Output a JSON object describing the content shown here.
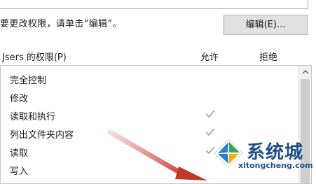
{
  "instruction": "要更改权限，请单击“编辑”。",
  "edit_button_label": "编辑(E)...",
  "permissions_header": {
    "name": "Jsers 的权限(P)",
    "allow": "允许",
    "deny": "拒绝"
  },
  "permissions": [
    {
      "name": "完全控制",
      "allow": false,
      "deny": false
    },
    {
      "name": "修改",
      "allow": false,
      "deny": false
    },
    {
      "name": "读取和执行",
      "allow": true,
      "deny": false
    },
    {
      "name": "列出文件夹内容",
      "allow": true,
      "deny": false
    },
    {
      "name": "读取",
      "allow": true,
      "deny": false
    },
    {
      "name": "写入",
      "allow": false,
      "deny": false
    }
  ],
  "watermark": {
    "title": "系统城",
    "url": "xitongcheng.com"
  },
  "colors": {
    "check": "#9a9a9a",
    "arrow": "#c0392b",
    "watermark_blue": "#1f4e8a"
  }
}
